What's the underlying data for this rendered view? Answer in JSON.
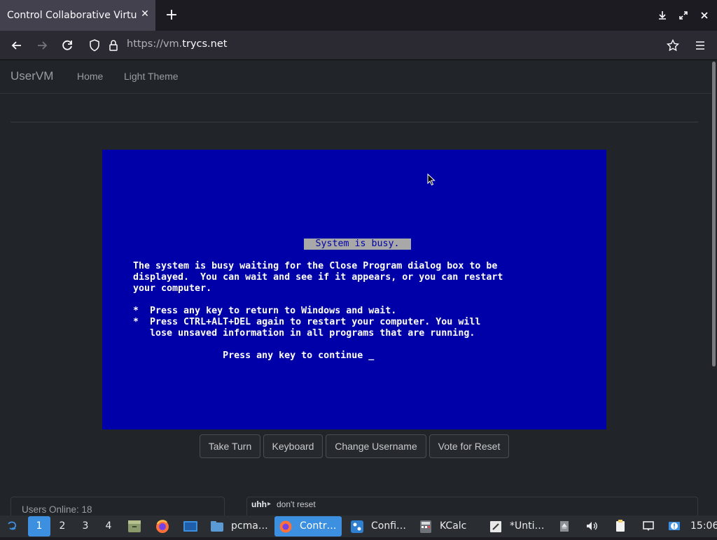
{
  "browser": {
    "tab_title": "Control Collaborative Virtual",
    "tab_close": "✕",
    "new_tab": "+",
    "url_prefix": "https://vm.",
    "url_domain": "trycs.net"
  },
  "site": {
    "brand": "UserVM",
    "nav": [
      "Home",
      "Light Theme"
    ]
  },
  "vm": {
    "title": " System is busy. ",
    "lines": [
      "The system is busy waiting for the Close Program dialog box to be",
      "displayed.  You can wait and see if it appears, or you can restart",
      "your computer.",
      "",
      "*  Press any key to return to Windows and wait.",
      "*  Press CTRL+ALT+DEL again to restart your computer. You will",
      "   lose unsaved information in all programs that are running.",
      "",
      "                Press any key to continue _"
    ],
    "buttons": [
      "Take Turn",
      "Keyboard",
      "Change Username",
      "Vote for Reset"
    ]
  },
  "users_online": "Users Online: 18",
  "chat": {
    "user": "uhh",
    "arrow": "▸",
    "message": "don't reset"
  },
  "taskbar": {
    "workspaces": [
      "1",
      "2",
      "3",
      "4"
    ],
    "active_workspace": "1",
    "tasks": [
      {
        "label": "pcma…",
        "icon": "folder-icon"
      },
      {
        "label": "Contr…",
        "icon": "firefox-icon",
        "active": true
      },
      {
        "label": "Confi…",
        "icon": "settings-icon"
      },
      {
        "label": "KCalc",
        "icon": "calculator-icon"
      },
      {
        "label": "*Unti…",
        "icon": "text-editor-icon"
      }
    ],
    "clock": "15:06"
  },
  "colors": {
    "vm_blue": "#0000a8",
    "accent": "#3d8fe0",
    "page_bg": "#212529"
  }
}
